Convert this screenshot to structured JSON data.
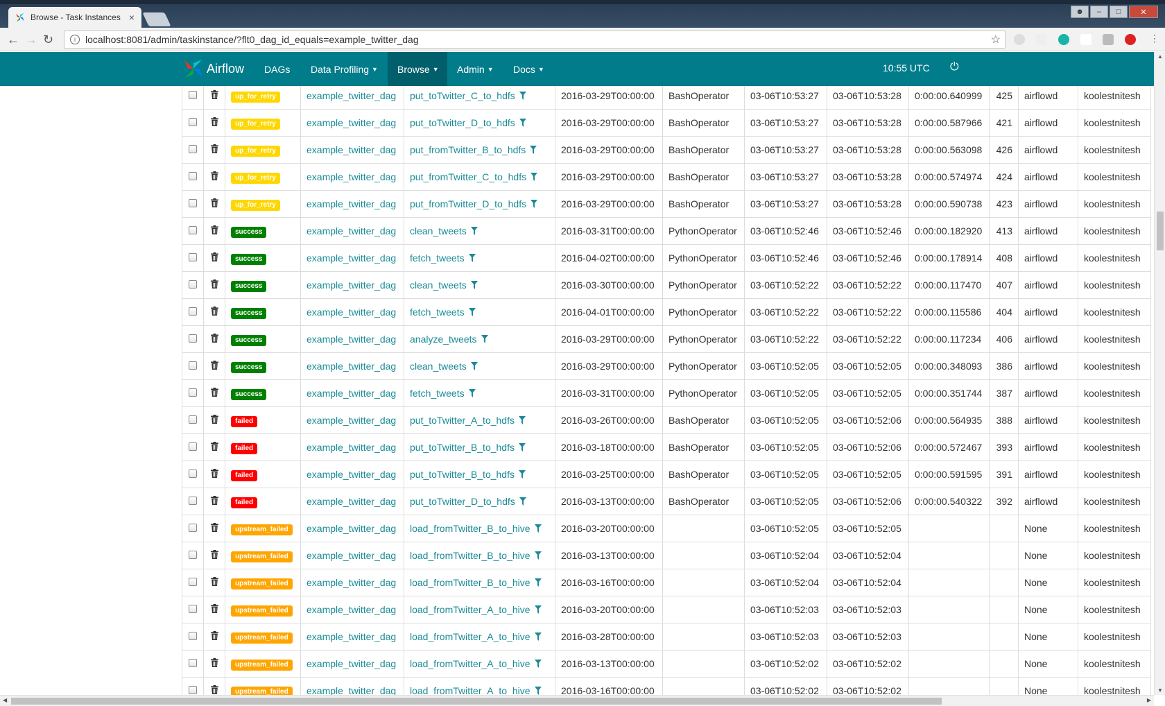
{
  "browser": {
    "tab_title": "Browse - Task Instances",
    "tab_close": "×",
    "url": "localhost:8081/admin/taskinstance/?flt0_dag_id_equals=example_twitter_dag"
  },
  "navbar": {
    "brand": "Airflow",
    "items": [
      {
        "label": "DAGs"
      },
      {
        "label": "Data Profiling"
      },
      {
        "label": "Browse"
      },
      {
        "label": "Admin"
      },
      {
        "label": "Docs"
      }
    ],
    "clock": "10:55 UTC"
  },
  "colors": {
    "navbar": "#017c8b",
    "up_for_retry": "#ffd700",
    "success": "#008000",
    "failed": "#ff0000",
    "upstream_failed": "#ffa500"
  },
  "rows": [
    {
      "state": "up_for_retry",
      "dag": "example_twitter_dag",
      "task": "put_toTwitter_C_to_hdfs",
      "exec_date": "2016-03-29T00:00:00",
      "operator": "BashOperator",
      "start": "03-06T10:53:27",
      "end": "03-06T10:53:28",
      "duration": "0:00:00.640999",
      "pid": "425",
      "hostname": "airflowd",
      "user": "koolestnitesh"
    },
    {
      "state": "up_for_retry",
      "dag": "example_twitter_dag",
      "task": "put_toTwitter_D_to_hdfs",
      "exec_date": "2016-03-29T00:00:00",
      "operator": "BashOperator",
      "start": "03-06T10:53:27",
      "end": "03-06T10:53:28",
      "duration": "0:00:00.587966",
      "pid": "421",
      "hostname": "airflowd",
      "user": "koolestnitesh"
    },
    {
      "state": "up_for_retry",
      "dag": "example_twitter_dag",
      "task": "put_fromTwitter_B_to_hdfs",
      "exec_date": "2016-03-29T00:00:00",
      "operator": "BashOperator",
      "start": "03-06T10:53:27",
      "end": "03-06T10:53:28",
      "duration": "0:00:00.563098",
      "pid": "426",
      "hostname": "airflowd",
      "user": "koolestnitesh"
    },
    {
      "state": "up_for_retry",
      "dag": "example_twitter_dag",
      "task": "put_fromTwitter_C_to_hdfs",
      "exec_date": "2016-03-29T00:00:00",
      "operator": "BashOperator",
      "start": "03-06T10:53:27",
      "end": "03-06T10:53:28",
      "duration": "0:00:00.574974",
      "pid": "424",
      "hostname": "airflowd",
      "user": "koolestnitesh"
    },
    {
      "state": "up_for_retry",
      "dag": "example_twitter_dag",
      "task": "put_fromTwitter_D_to_hdfs",
      "exec_date": "2016-03-29T00:00:00",
      "operator": "BashOperator",
      "start": "03-06T10:53:27",
      "end": "03-06T10:53:28",
      "duration": "0:00:00.590738",
      "pid": "423",
      "hostname": "airflowd",
      "user": "koolestnitesh"
    },
    {
      "state": "success",
      "dag": "example_twitter_dag",
      "task": "clean_tweets",
      "exec_date": "2016-03-31T00:00:00",
      "operator": "PythonOperator",
      "start": "03-06T10:52:46",
      "end": "03-06T10:52:46",
      "duration": "0:00:00.182920",
      "pid": "413",
      "hostname": "airflowd",
      "user": "koolestnitesh"
    },
    {
      "state": "success",
      "dag": "example_twitter_dag",
      "task": "fetch_tweets",
      "exec_date": "2016-04-02T00:00:00",
      "operator": "PythonOperator",
      "start": "03-06T10:52:46",
      "end": "03-06T10:52:46",
      "duration": "0:00:00.178914",
      "pid": "408",
      "hostname": "airflowd",
      "user": "koolestnitesh"
    },
    {
      "state": "success",
      "dag": "example_twitter_dag",
      "task": "clean_tweets",
      "exec_date": "2016-03-30T00:00:00",
      "operator": "PythonOperator",
      "start": "03-06T10:52:22",
      "end": "03-06T10:52:22",
      "duration": "0:00:00.117470",
      "pid": "407",
      "hostname": "airflowd",
      "user": "koolestnitesh"
    },
    {
      "state": "success",
      "dag": "example_twitter_dag",
      "task": "fetch_tweets",
      "exec_date": "2016-04-01T00:00:00",
      "operator": "PythonOperator",
      "start": "03-06T10:52:22",
      "end": "03-06T10:52:22",
      "duration": "0:00:00.115586",
      "pid": "404",
      "hostname": "airflowd",
      "user": "koolestnitesh"
    },
    {
      "state": "success",
      "dag": "example_twitter_dag",
      "task": "analyze_tweets",
      "exec_date": "2016-03-29T00:00:00",
      "operator": "PythonOperator",
      "start": "03-06T10:52:22",
      "end": "03-06T10:52:22",
      "duration": "0:00:00.117234",
      "pid": "406",
      "hostname": "airflowd",
      "user": "koolestnitesh"
    },
    {
      "state": "success",
      "dag": "example_twitter_dag",
      "task": "clean_tweets",
      "exec_date": "2016-03-29T00:00:00",
      "operator": "PythonOperator",
      "start": "03-06T10:52:05",
      "end": "03-06T10:52:05",
      "duration": "0:00:00.348093",
      "pid": "386",
      "hostname": "airflowd",
      "user": "koolestnitesh"
    },
    {
      "state": "success",
      "dag": "example_twitter_dag",
      "task": "fetch_tweets",
      "exec_date": "2016-03-31T00:00:00",
      "operator": "PythonOperator",
      "start": "03-06T10:52:05",
      "end": "03-06T10:52:05",
      "duration": "0:00:00.351744",
      "pid": "387",
      "hostname": "airflowd",
      "user": "koolestnitesh"
    },
    {
      "state": "failed",
      "dag": "example_twitter_dag",
      "task": "put_toTwitter_A_to_hdfs",
      "exec_date": "2016-03-26T00:00:00",
      "operator": "BashOperator",
      "start": "03-06T10:52:05",
      "end": "03-06T10:52:06",
      "duration": "0:00:00.564935",
      "pid": "388",
      "hostname": "airflowd",
      "user": "koolestnitesh"
    },
    {
      "state": "failed",
      "dag": "example_twitter_dag",
      "task": "put_toTwitter_B_to_hdfs",
      "exec_date": "2016-03-18T00:00:00",
      "operator": "BashOperator",
      "start": "03-06T10:52:05",
      "end": "03-06T10:52:06",
      "duration": "0:00:00.572467",
      "pid": "393",
      "hostname": "airflowd",
      "user": "koolestnitesh"
    },
    {
      "state": "failed",
      "dag": "example_twitter_dag",
      "task": "put_toTwitter_B_to_hdfs",
      "exec_date": "2016-03-25T00:00:00",
      "operator": "BashOperator",
      "start": "03-06T10:52:05",
      "end": "03-06T10:52:05",
      "duration": "0:00:00.591595",
      "pid": "391",
      "hostname": "airflowd",
      "user": "koolestnitesh"
    },
    {
      "state": "failed",
      "dag": "example_twitter_dag",
      "task": "put_toTwitter_D_to_hdfs",
      "exec_date": "2016-03-13T00:00:00",
      "operator": "BashOperator",
      "start": "03-06T10:52:05",
      "end": "03-06T10:52:06",
      "duration": "0:00:00.540322",
      "pid": "392",
      "hostname": "airflowd",
      "user": "koolestnitesh"
    },
    {
      "state": "upstream_failed",
      "dag": "example_twitter_dag",
      "task": "load_fromTwitter_B_to_hive",
      "exec_date": "2016-03-20T00:00:00",
      "operator": "",
      "start": "03-06T10:52:05",
      "end": "03-06T10:52:05",
      "duration": "",
      "pid": "",
      "hostname": "None",
      "user": "koolestnitesh"
    },
    {
      "state": "upstream_failed",
      "dag": "example_twitter_dag",
      "task": "load_fromTwitter_B_to_hive",
      "exec_date": "2016-03-13T00:00:00",
      "operator": "",
      "start": "03-06T10:52:04",
      "end": "03-06T10:52:04",
      "duration": "",
      "pid": "",
      "hostname": "None",
      "user": "koolestnitesh"
    },
    {
      "state": "upstream_failed",
      "dag": "example_twitter_dag",
      "task": "load_fromTwitter_B_to_hive",
      "exec_date": "2016-03-16T00:00:00",
      "operator": "",
      "start": "03-06T10:52:04",
      "end": "03-06T10:52:04",
      "duration": "",
      "pid": "",
      "hostname": "None",
      "user": "koolestnitesh"
    },
    {
      "state": "upstream_failed",
      "dag": "example_twitter_dag",
      "task": "load_fromTwitter_A_to_hive",
      "exec_date": "2016-03-20T00:00:00",
      "operator": "",
      "start": "03-06T10:52:03",
      "end": "03-06T10:52:03",
      "duration": "",
      "pid": "",
      "hostname": "None",
      "user": "koolestnitesh"
    },
    {
      "state": "upstream_failed",
      "dag": "example_twitter_dag",
      "task": "load_fromTwitter_A_to_hive",
      "exec_date": "2016-03-28T00:00:00",
      "operator": "",
      "start": "03-06T10:52:03",
      "end": "03-06T10:52:03",
      "duration": "",
      "pid": "",
      "hostname": "None",
      "user": "koolestnitesh"
    },
    {
      "state": "upstream_failed",
      "dag": "example_twitter_dag",
      "task": "load_fromTwitter_A_to_hive",
      "exec_date": "2016-03-13T00:00:00",
      "operator": "",
      "start": "03-06T10:52:02",
      "end": "03-06T10:52:02",
      "duration": "",
      "pid": "",
      "hostname": "None",
      "user": "koolestnitesh"
    },
    {
      "state": "upstream_failed",
      "dag": "example_twitter_dag",
      "task": "load_fromTwitter_A_to_hive",
      "exec_date": "2016-03-16T00:00:00",
      "operator": "",
      "start": "03-06T10:52:02",
      "end": "03-06T10:52:02",
      "duration": "",
      "pid": "",
      "hostname": "None",
      "user": "koolestnitesh"
    }
  ]
}
